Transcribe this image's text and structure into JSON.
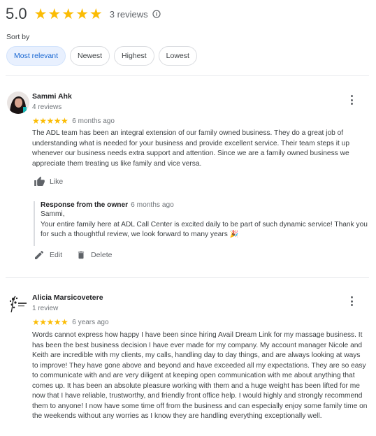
{
  "summary": {
    "score": "5.0",
    "rating": 5,
    "count_label": "3 reviews",
    "info_icon": "info-icon"
  },
  "sort": {
    "label": "Sort by",
    "options": [
      "Most relevant",
      "Newest",
      "Highest",
      "Lowest"
    ],
    "selected": "Most relevant"
  },
  "reviews": [
    {
      "name": "Sammi Ahk",
      "meta": "4 reviews",
      "rating": 5,
      "date": "6 months ago",
      "text": "The ADL team has been an integral extension of our family owned business. They do a great job of understanding what is needed for your business and provide excellent service. Their team steps it up whenever our business needs extra support and attention. Since we are a family owned business we appreciate them treating us like family and vice versa.",
      "like_label": "Like",
      "owner_response": {
        "title": "Response from the owner",
        "date": "6 months ago",
        "greeting": "Sammi,",
        "text": "Your entire family here at ADL Call Center is excited daily to be part of such dynamic service! Thank you for such a thoughtful review, we look forward to many years 🎉"
      },
      "edit_label": "Edit",
      "delete_label": "Delete"
    },
    {
      "name": "Alicia Marsicovetere",
      "meta": "1 review",
      "rating": 5,
      "date": "6 years ago",
      "text": "Words cannot express how happy I have been since hiring Avail Dream Link for my massage business. It has been the best business decision I have ever made for my company. My account manager Nicole and Keith are incredible with my clients, my calls, handling day to day things, and are always looking at ways to improve! They have gone above and beyond and have exceeded all my expectations. They are so easy to communicate with and are very diligent at keeping open communication with me about anything that comes up. It has been an absolute pleasure working with them and a huge weight has been lifted for me now that I have reliable, trustworthy, and friendly front office help. I would highly and strongly recommend them to anyone! I now have some time off from the business and can especially enjoy some family time on the weekends without any worries as I know they are handling everything exceptionally well."
    }
  ],
  "colors": {
    "star": "#fbbc04",
    "chip_active_bg": "#e8f0fe",
    "chip_active_text": "#1967d2"
  }
}
